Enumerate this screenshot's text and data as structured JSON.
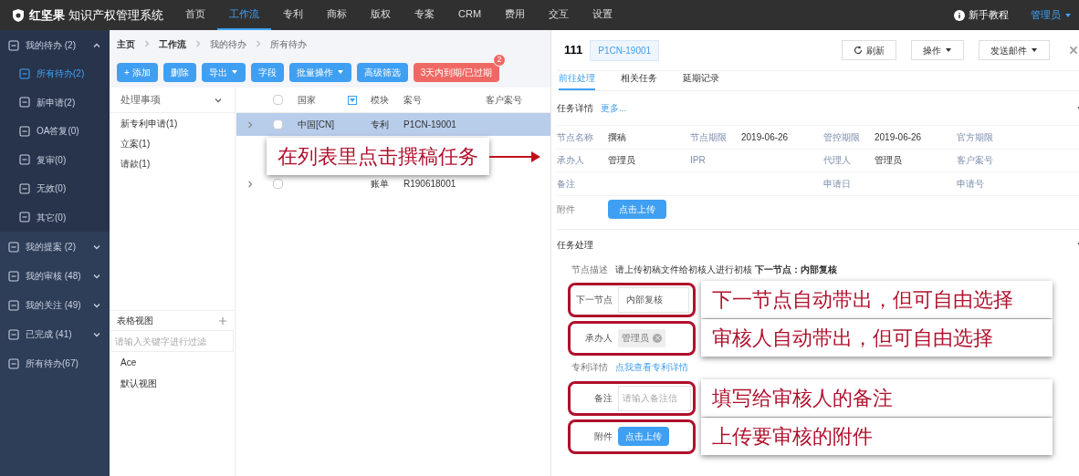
{
  "app": {
    "logo_text": "红坚果",
    "title": "知识产权管理系统"
  },
  "nav": [
    {
      "label": "首页",
      "selected": false
    },
    {
      "label": "工作流",
      "selected": true
    },
    {
      "label": "专利",
      "selected": false
    },
    {
      "label": "商标",
      "selected": false
    },
    {
      "label": "版权",
      "selected": false
    },
    {
      "label": "专案",
      "selected": false
    },
    {
      "label": "CRM",
      "selected": false
    },
    {
      "label": "费用",
      "selected": false
    },
    {
      "label": "交互",
      "selected": false
    },
    {
      "label": "设置",
      "selected": false
    }
  ],
  "help": "新手教程",
  "user": "管理员",
  "sidebar": {
    "items": [
      {
        "label": "我的待办 (2)",
        "expanded": true,
        "children": [
          {
            "label": "所有待办(2)",
            "selected": true
          },
          {
            "label": "新申请(2)",
            "selected": false
          },
          {
            "label": "OA答复(0)",
            "selected": false
          },
          {
            "label": "复审(0)",
            "selected": false
          },
          {
            "label": "无效(0)",
            "selected": false
          },
          {
            "label": "其它(0)",
            "selected": false
          }
        ]
      },
      {
        "label": "我的提案 (2)",
        "expanded": false
      },
      {
        "label": "我的审核 (48)",
        "expanded": false
      },
      {
        "label": "我的关注 (49)",
        "expanded": false
      },
      {
        "label": "已完成 (41)",
        "expanded": false
      },
      {
        "label": "所有待办(67)"
      }
    ]
  },
  "breadcrumb": [
    "主页",
    "工作流",
    "我的待办",
    "所有待办"
  ],
  "toolbar": [
    {
      "label": "+ 添加",
      "kind": "plain"
    },
    {
      "label": "删除",
      "kind": "plain"
    },
    {
      "label": "导出",
      "kind": "menu"
    },
    {
      "label": "字段",
      "kind": "plain"
    },
    {
      "label": "批量操作",
      "kind": "menu"
    },
    {
      "label": "高级筛选",
      "kind": "plain"
    },
    {
      "label": "3天内到期/已过期",
      "kind": "alert",
      "badge": "2"
    }
  ],
  "filter": {
    "title": "处理事项",
    "items": [
      "新专利申请(1)",
      "立案(1)",
      "请款(1)"
    ]
  },
  "views": {
    "title": "表格视图",
    "placeholder": "请输入关键字进行过滤",
    "items": [
      "Ace",
      "默认视图"
    ]
  },
  "table": {
    "all_checked": false,
    "columns": [
      "国家",
      "模块",
      "案号",
      "客户案号"
    ],
    "rows": [
      {
        "selected": true,
        "checked": false,
        "cells": [
          "中国[CN]",
          "专利",
          "P1CN-19001",
          ""
        ]
      },
      {
        "selected": false,
        "checked": false,
        "cells": [
          "",
          "账单",
          "R190618001",
          ""
        ]
      }
    ]
  },
  "callout_list": "在列表里点击撰稿任务",
  "detail": {
    "number": "111",
    "tag": "P1CN-19001",
    "actions": [
      {
        "label": "刷新",
        "kind": "refresh"
      },
      {
        "label": "操作",
        "kind": "menu"
      },
      {
        "label": "发送邮件",
        "kind": "menu"
      }
    ],
    "tabs": [
      {
        "label": "前往处理",
        "selected": true
      },
      {
        "label": "相关任务",
        "selected": false
      },
      {
        "label": "延期记录",
        "selected": false
      }
    ],
    "info_title": "任务详情",
    "info_more": "更多...",
    "info_rows": [
      [
        [
          "节点名称",
          "撰稿"
        ],
        [
          "节点期限",
          "2019-06-26"
        ],
        [
          "管控期限",
          "2019-06-26"
        ],
        [
          "官方期限",
          ""
        ]
      ],
      [
        [
          "承办人",
          "管理员"
        ],
        [
          "IPR",
          ""
        ],
        [
          "代理人",
          "管理员"
        ],
        [
          "客户案号",
          ""
        ]
      ],
      [
        [
          "备注",
          ""
        ],
        [
          "",
          ""
        ],
        [
          "申请日",
          ""
        ],
        [
          "申请号",
          ""
        ]
      ]
    ],
    "attach_label": "附件",
    "upload": "点击上传",
    "process_title": "任务处理",
    "node_desc_label": "节点描述",
    "node_desc": "请上传初稿文件给初核人进行初核 **下一节点：内部复核**",
    "form": [
      {
        "kind": "select",
        "label": "下一节点",
        "value": "内部复核",
        "callout": "下一节点自动带出，但可自由选择"
      },
      {
        "kind": "tag",
        "label": "承办人",
        "value": "管理员",
        "callout": "审核人自动带出，但可自由选择"
      },
      {
        "kind": "link",
        "label": "专利详情",
        "value": "点我查看专利详情"
      },
      {
        "kind": "input",
        "label": "备注",
        "placeholder": "请输入备注信",
        "callout": "填写给审核人的备注"
      },
      {
        "kind": "upload",
        "label": "附件",
        "value": "点击上传",
        "callout": "上传要审核的附件"
      }
    ]
  }
}
